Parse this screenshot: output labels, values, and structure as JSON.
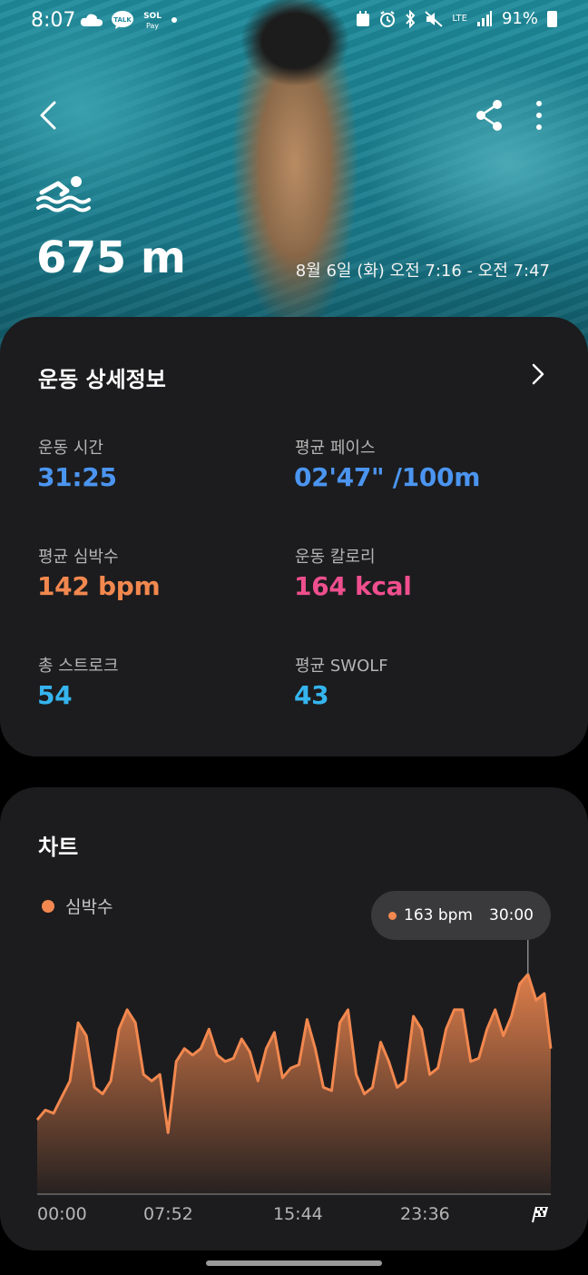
{
  "status_bar": {
    "time": "8:07",
    "left_icons": [
      "cloud-icon",
      "kakaotalk-icon",
      "sol-pay-icon",
      "dot-icon"
    ],
    "right_icons": [
      "calendar-icon",
      "alarm-icon",
      "bluetooth-icon",
      "mute-icon",
      "lte-icon",
      "signal-icon"
    ],
    "lte_label": "LTE",
    "battery": "91%"
  },
  "header": {
    "activity_icon": "swimming-icon",
    "distance": "675 m",
    "date_range": "8월 6일 (화) 오전 7:16 - 오전 7:47"
  },
  "details": {
    "title": "운동 상세정보",
    "metrics": [
      {
        "label": "운동 시간",
        "value": "31:25",
        "color": "#4b95f0"
      },
      {
        "label": "평균 페이스",
        "value": "02'47\" /100m",
        "color": "#4b95f0"
      },
      {
        "label": "평균 심박수",
        "value": "142 bpm",
        "color": "#f2884f"
      },
      {
        "label": "운동 칼로리",
        "value": "164 kcal",
        "color": "#ef4f8e"
      },
      {
        "label": "총 스트로크",
        "value": "54",
        "color": "#35b4ee"
      },
      {
        "label": "평균 SWOLF",
        "value": "43",
        "color": "#35b4ee"
      }
    ]
  },
  "chart": {
    "title": "차트",
    "legend": "심박수",
    "tooltip": {
      "value": "163 bpm",
      "time": "30:00"
    },
    "x_labels": [
      "00:00",
      "07:52",
      "15:44",
      "23:36"
    ]
  },
  "chart_data": {
    "type": "area",
    "series": [
      {
        "name": "심박수",
        "x": [
          0,
          0.5,
          1,
          1.5,
          2,
          2.5,
          3,
          3.5,
          4,
          4.5,
          5,
          5.5,
          6,
          6.5,
          7,
          7.5,
          8,
          8.5,
          9,
          9.5,
          10,
          10.5,
          11,
          11.5,
          12,
          12.5,
          13,
          13.5,
          14,
          14.5,
          15,
          15.5,
          16,
          16.5,
          17,
          17.5,
          18,
          18.5,
          19,
          19.5,
          20,
          20.5,
          21,
          21.5,
          22,
          22.5,
          23,
          23.5,
          24,
          24.5,
          25,
          25.5,
          26,
          26.5,
          27,
          27.5,
          28,
          28.5,
          29,
          29.5,
          30,
          30.5,
          31,
          31.4
        ],
        "values": [
          118,
          121,
          120,
          125,
          130,
          148,
          144,
          128,
          126,
          130,
          146,
          152,
          148,
          132,
          130,
          132,
          114,
          136,
          140,
          138,
          140,
          146,
          138,
          136,
          137,
          143,
          139,
          130,
          140,
          145,
          131,
          134,
          135,
          149,
          140,
          128,
          127,
          148,
          152,
          132,
          126,
          128,
          142,
          136,
          128,
          130,
          150,
          146,
          132,
          134,
          146,
          152,
          152,
          136,
          137,
          146,
          152,
          144,
          150,
          160,
          163,
          155,
          157,
          140
        ]
      }
    ],
    "xlim": [
      0,
      31.4
    ],
    "x_tick_labels": [
      "00:00",
      "07:52",
      "15:44",
      "23:36"
    ],
    "ylim": [
      95,
      175
    ],
    "color": "#f2884f",
    "legend_position": "top-left"
  }
}
